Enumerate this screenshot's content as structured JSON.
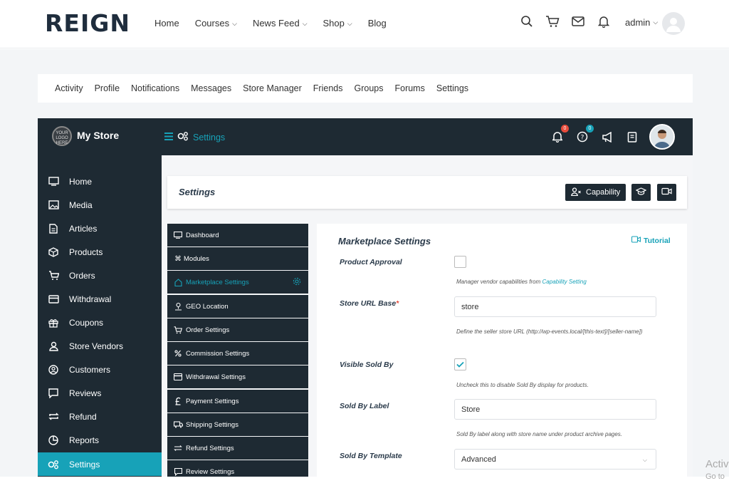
{
  "header": {
    "logo": "REIGN",
    "nav": [
      "Home",
      "Courses",
      "News Feed",
      "Shop",
      "Blog"
    ],
    "nav_has_dropdown": [
      false,
      true,
      true,
      true,
      false
    ],
    "user": "admin"
  },
  "subnav": [
    "Activity",
    "Profile",
    "Notifications",
    "Messages",
    "Store Manager",
    "Friends",
    "Groups",
    "Forums",
    "Settings"
  ],
  "store": {
    "name": "My Store",
    "logo_text": "YOUR LOGO HERE",
    "breadcrumb": "Settings",
    "notifications_count": "0",
    "help_count": "0"
  },
  "sidebar": {
    "items": [
      {
        "label": "Home",
        "icon": "monitor-icon"
      },
      {
        "label": "Media",
        "icon": "image-icon"
      },
      {
        "label": "Articles",
        "icon": "document-icon"
      },
      {
        "label": "Products",
        "icon": "cube-icon"
      },
      {
        "label": "Orders",
        "icon": "cart-icon"
      },
      {
        "label": "Withdrawal",
        "icon": "card-icon"
      },
      {
        "label": "Coupons",
        "icon": "gift-icon"
      },
      {
        "label": "Store Vendors",
        "icon": "user-icon"
      },
      {
        "label": "Customers",
        "icon": "user-circle-icon"
      },
      {
        "label": "Reviews",
        "icon": "comment-icon"
      },
      {
        "label": "Refund",
        "icon": "refund-icon"
      },
      {
        "label": "Reports",
        "icon": "chart-pie-icon"
      },
      {
        "label": "Settings",
        "icon": "gears-icon"
      }
    ],
    "active": "Settings"
  },
  "settings_bar": {
    "title": "Settings",
    "capability_label": "Capability"
  },
  "settings_menu": {
    "items": [
      {
        "label": "Dashboard",
        "icon": "monitor-icon"
      },
      {
        "label": "Modules",
        "icon": "modules-icon"
      },
      {
        "label": "Marketplace Settings",
        "icon": "home-icon"
      },
      {
        "label": "GEO Location",
        "icon": "location-icon"
      },
      {
        "label": "Order Settings",
        "icon": "cart-icon"
      },
      {
        "label": "Commission Settings",
        "icon": "percent-icon"
      },
      {
        "label": "Withdrawal Settings",
        "icon": "card-icon"
      },
      {
        "label": "Payment Settings",
        "icon": "pound-icon"
      },
      {
        "label": "Shipping Settings",
        "icon": "truck-icon"
      },
      {
        "label": "Refund Settings",
        "icon": "refund-icon"
      },
      {
        "label": "Review Settings",
        "icon": "comment-icon"
      }
    ],
    "active": "Marketplace Settings",
    "modules_glyph": "⌘"
  },
  "form": {
    "title": "Marketplace Settings",
    "tutorial": "Tutorial",
    "product_approval": {
      "label": "Product Approval",
      "checked": false
    },
    "capability_help_prefix": "Manager vendor capabilities from ",
    "capability_help_link": "Capability Setting",
    "store_url_base": {
      "label": "Store URL Base",
      "required": "*",
      "value": "store",
      "help": "Define the seller store URL (http://wp-events.local/[this-text]/[seller-name])"
    },
    "visible_sold_by": {
      "label": "Visible Sold By",
      "checked": true,
      "help": "Uncheck this to disable Sold By display for products."
    },
    "sold_by_label": {
      "label": "Sold By Label",
      "value": "Store",
      "help": "Sold By label along with store name under product archive pages."
    },
    "sold_by_template": {
      "label": "Sold By Template",
      "value": "Advanced"
    }
  },
  "watermark": {
    "line1": "Activ",
    "line2": "Go to"
  },
  "colors": {
    "accent": "#17a2b8",
    "dark": "#1e2a33",
    "badge_red": "#e74c3c",
    "badge_teal": "#17a2b8"
  }
}
